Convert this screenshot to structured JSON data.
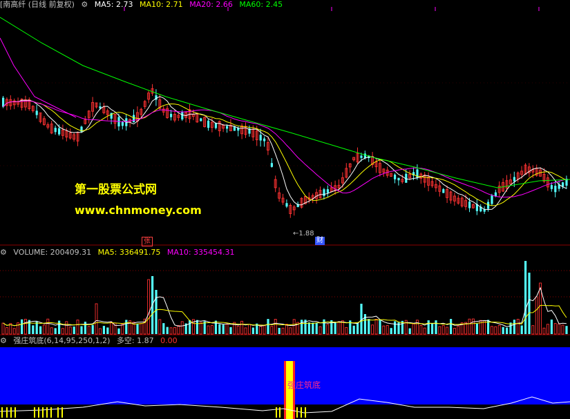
{
  "header": {
    "title": "[南高纤 (日线 前复权)",
    "ma_labels": [
      {
        "text": "MA5: 2.73",
        "color": "#ffffff"
      },
      {
        "text": "MA10: 2.71",
        "color": "#ffff00"
      },
      {
        "text": "MA20: 2.66",
        "color": "#ff00ff"
      },
      {
        "text": "MA60: 2.45",
        "color": "#00ff00"
      }
    ]
  },
  "watermark": {
    "line1": "第一股票公式网",
    "line2": "www.chnmoney.com"
  },
  "markers": {
    "zhang": "张",
    "cai": "财",
    "low": "1.88"
  },
  "volume_header": {
    "label": "VOLUME: 200409.31",
    "ma5": "MA5: 336491.75",
    "ma10": "MA10: 335454.31"
  },
  "indicator_header": {
    "name": "强庄筑底(6,14,95,250,1,2)",
    "duokong": "多空: 1.87",
    "value": "0.00"
  },
  "indicator_signal": "强庄筑底",
  "colors": {
    "up": "#ff3232",
    "down": "#54fcfc",
    "ma5": "#ffffff",
    "ma10": "#ffff00",
    "ma20": "#ff00ff",
    "ma60": "#00ff00",
    "indicator_bg": "#0000ff"
  },
  "chart_data": [
    {
      "type": "candlestick",
      "title": "[南高纤 (日线 前复权)",
      "series": [
        {
          "name": "MA5",
          "values": []
        },
        {
          "name": "MA10",
          "values": []
        },
        {
          "name": "MA20",
          "values": []
        },
        {
          "name": "MA60",
          "values": []
        }
      ],
      "annotations": [
        "1.88",
        "张",
        "财"
      ]
    },
    {
      "type": "bar",
      "title": "VOLUME: 200409.31"
    },
    {
      "type": "area",
      "title": "强庄筑底(6,14,95,250,1,2)"
    }
  ]
}
